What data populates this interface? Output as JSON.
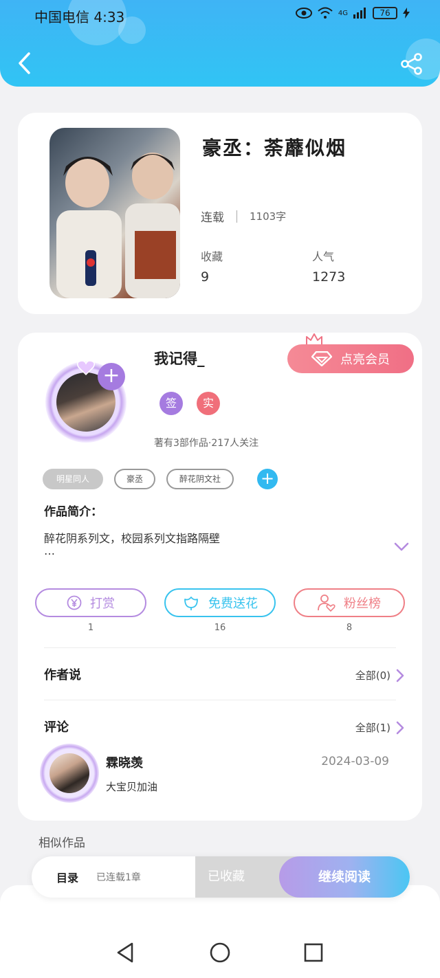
{
  "status_bar": {
    "carrier_time": "中国电信 4:33",
    "network": "4G",
    "battery": "76"
  },
  "book": {
    "title": "豪丞：荼蘼似烟",
    "status": "连载",
    "word_count": "1103字",
    "favorites_label": "收藏",
    "favorites_value": "9",
    "popularity_label": "人气",
    "popularity_value": "1273"
  },
  "author": {
    "name": "我记得_",
    "vip_button": "点亮会员",
    "badges": [
      "签",
      "实"
    ],
    "stats": "著有3部作品·217人关注",
    "tags": [
      "明星同人",
      "豪丞",
      "醉花阴文社"
    ],
    "intro_label": "作品简介：",
    "intro_text": "醉花阴系列文，校园系列文指路隔壁",
    "intro_ellipsis": "…"
  },
  "actions": [
    {
      "label": "打赏",
      "count": "1",
      "color": "#b48be0"
    },
    {
      "label": "免费送花",
      "count": "16",
      "color": "#38c3ee"
    },
    {
      "label": "粉丝榜",
      "count": "8",
      "color": "#ef7f86"
    }
  ],
  "author_says": {
    "title": "作者说",
    "link": "全部(0)"
  },
  "comments": {
    "title": "评论",
    "link": "全部(1)",
    "items": [
      {
        "name": "霖晓羡",
        "date": "2024-03-09",
        "text": "大宝贝加油"
      }
    ]
  },
  "similar_title": "相似作品",
  "reading_bar": {
    "toc_label": "目录",
    "toc_info": "已连载1章",
    "collected_label": "已收藏",
    "continue_label": "继续阅读"
  },
  "colors": {
    "header": "#3fb4f5",
    "purple_accent": "#a57be0",
    "blue_accent": "#32b9f0",
    "pink_accent": "#f06f85"
  }
}
